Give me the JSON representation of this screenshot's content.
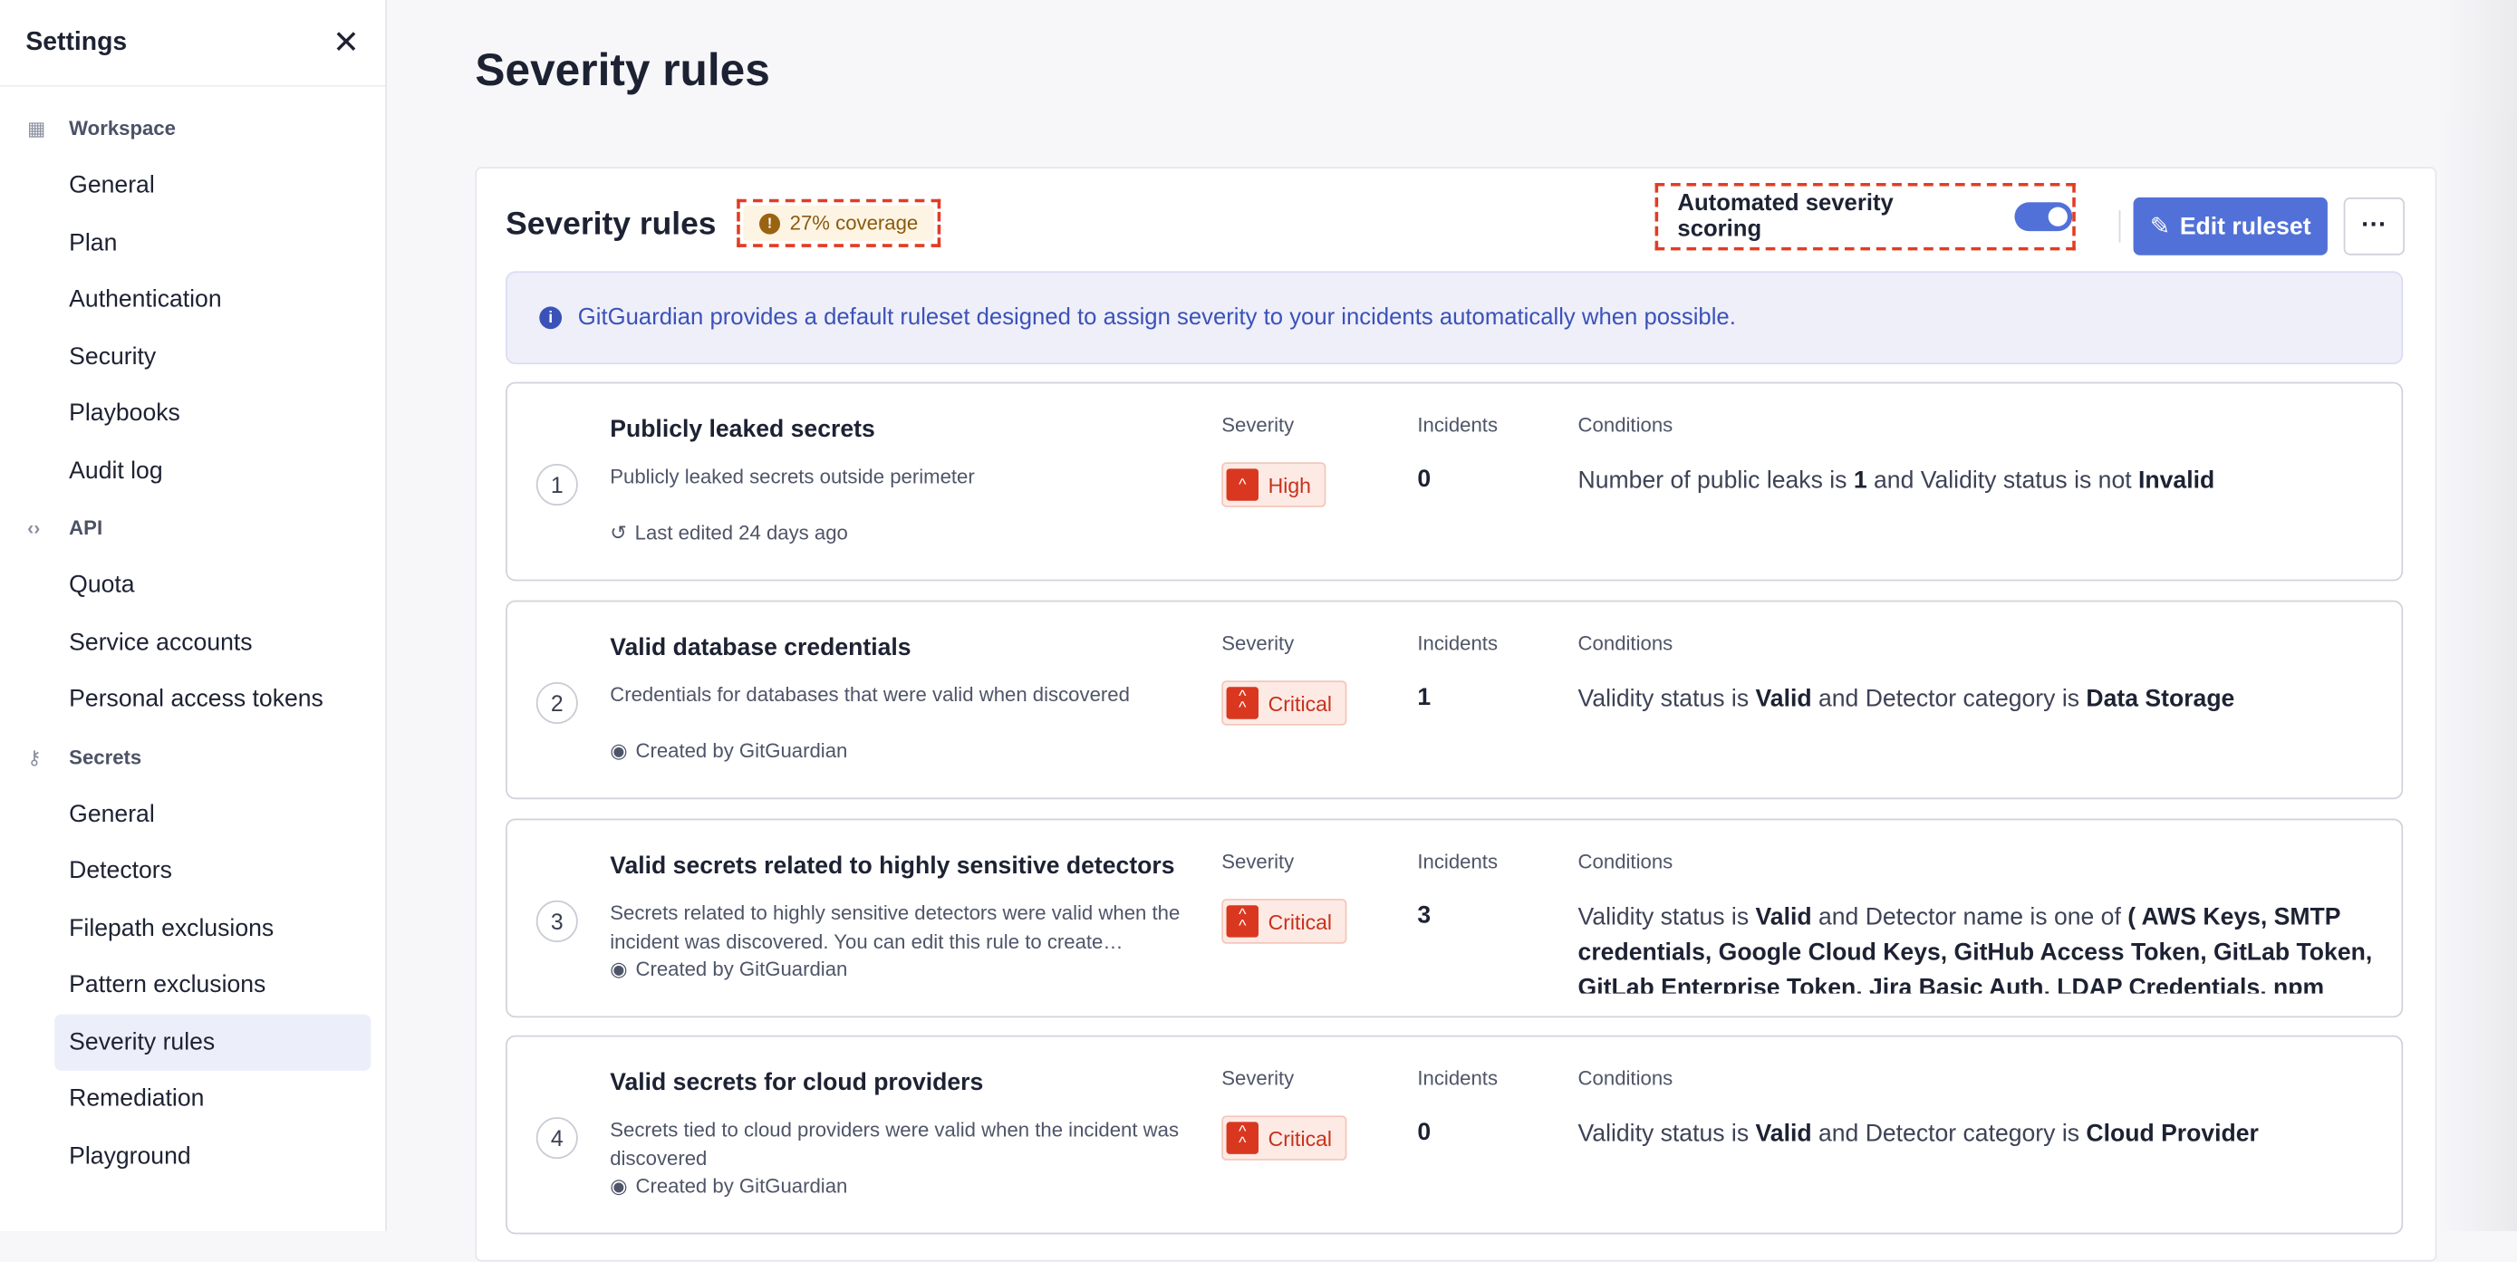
{
  "sidebar": {
    "title": "Settings",
    "sections": [
      {
        "label": "Workspace",
        "icon": "building-icon",
        "items": [
          "General",
          "Plan",
          "Authentication",
          "Security",
          "Playbooks",
          "Audit log"
        ]
      },
      {
        "label": "API",
        "icon": "code-icon",
        "items": [
          "Quota",
          "Service accounts",
          "Personal access tokens"
        ]
      },
      {
        "label": "Secrets",
        "icon": "key-icon",
        "items": [
          "General",
          "Detectors",
          "Filepath exclusions",
          "Pattern exclusions",
          "Severity rules",
          "Remediation",
          "Playground"
        ]
      }
    ],
    "active": "Severity rules"
  },
  "page_title": "Severity rules",
  "card": {
    "title": "Severity rules",
    "coverage": "27% coverage",
    "auto_label": "Automated severity scoring",
    "auto_enabled": true,
    "edit_label": "Edit ruleset",
    "more_label": "···",
    "info": "GitGuardian provides a default ruleset designed to assign severity to your incidents automatically when possible.",
    "col_severity": "Severity",
    "col_incidents": "Incidents",
    "col_conditions": "Conditions"
  },
  "colors": {
    "accent": "#5271d8",
    "critical": "#da3720",
    "warning": "#9a6312"
  },
  "rules": [
    {
      "num": "1",
      "title": "Publicly leaked secrets",
      "desc": "Publicly leaked secrets outside perimeter",
      "meta": "Last edited 24 days ago",
      "meta_icon": "history-icon",
      "severity": "High",
      "incidents": "0",
      "conditions": [
        [
          "Number of public leaks is ",
          ""
        ],
        [
          "1",
          "b"
        ],
        [
          " and Validity status is not ",
          ""
        ],
        [
          "Invalid",
          "b"
        ]
      ]
    },
    {
      "num": "2",
      "title": "Valid database credentials",
      "desc": "Credentials for databases that were valid when discovered",
      "meta": "Created by GitGuardian",
      "meta_icon": "gitguardian-logo-icon",
      "severity": "Critical",
      "incidents": "1",
      "conditions": [
        [
          "Validity status is ",
          ""
        ],
        [
          "Valid",
          "b"
        ],
        [
          " and Detector category is ",
          ""
        ],
        [
          "Data Storage",
          "b"
        ]
      ]
    },
    {
      "num": "3",
      "title": "Valid secrets related to highly sensitive detectors",
      "desc": "Secrets related to highly sensitive detectors were valid when the incident was discovered. You can edit this rule to create…",
      "meta": "Created by GitGuardian",
      "meta_icon": "gitguardian-logo-icon",
      "severity": "Critical",
      "incidents": "3",
      "conditions": [
        [
          "Validity status is ",
          ""
        ],
        [
          "Valid",
          "b"
        ],
        [
          " and Detector name is one of ",
          ""
        ],
        [
          "( AWS Keys, SMTP credentials, Google Cloud Keys, GitHub Access Token, GitLab Token, GitLab Enterprise Token, Jira Basic Auth, LDAP Credentials, npm Token",
          "b"
        ]
      ]
    },
    {
      "num": "4",
      "title": "Valid secrets for cloud providers",
      "desc": "Secrets tied to cloud providers were valid when the incident was discovered",
      "meta": "Created by GitGuardian",
      "meta_icon": "gitguardian-logo-icon",
      "severity": "Critical",
      "incidents": "0",
      "conditions": [
        [
          "Validity status is ",
          ""
        ],
        [
          "Valid",
          "b"
        ],
        [
          " and Detector category is ",
          ""
        ],
        [
          "Cloud Provider",
          "b"
        ]
      ]
    }
  ]
}
